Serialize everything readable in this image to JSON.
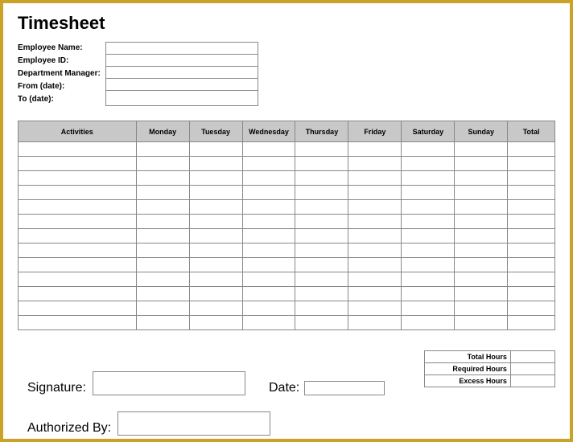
{
  "title": "Timesheet",
  "header": {
    "labels": {
      "employee_name": "Employee Name:",
      "employee_id": "Employee ID:",
      "department_manager": "Department Manager:",
      "from_date": "From (date):",
      "to_date": "To (date):"
    },
    "values": {
      "employee_name": "",
      "employee_id": "",
      "department_manager": "",
      "from_date": "",
      "to_date": ""
    }
  },
  "table": {
    "columns": [
      "Activities",
      "Monday",
      "Tuesday",
      "Wednesday",
      "Thursday",
      "Friday",
      "Saturday",
      "Sunday",
      "Total"
    ],
    "rows": [
      [
        "",
        "",
        "",
        "",
        "",
        "",
        "",
        "",
        ""
      ],
      [
        "",
        "",
        "",
        "",
        "",
        "",
        "",
        "",
        ""
      ],
      [
        "",
        "",
        "",
        "",
        "",
        "",
        "",
        "",
        ""
      ],
      [
        "",
        "",
        "",
        "",
        "",
        "",
        "",
        "",
        ""
      ],
      [
        "",
        "",
        "",
        "",
        "",
        "",
        "",
        "",
        ""
      ],
      [
        "",
        "",
        "",
        "",
        "",
        "",
        "",
        "",
        ""
      ],
      [
        "",
        "",
        "",
        "",
        "",
        "",
        "",
        "",
        ""
      ],
      [
        "",
        "",
        "",
        "",
        "",
        "",
        "",
        "",
        ""
      ],
      [
        "",
        "",
        "",
        "",
        "",
        "",
        "",
        "",
        ""
      ],
      [
        "",
        "",
        "",
        "",
        "",
        "",
        "",
        "",
        ""
      ],
      [
        "",
        "",
        "",
        "",
        "",
        "",
        "",
        "",
        ""
      ],
      [
        "",
        "",
        "",
        "",
        "",
        "",
        "",
        "",
        ""
      ],
      [
        "",
        "",
        "",
        "",
        "",
        "",
        "",
        "",
        ""
      ]
    ]
  },
  "summary": {
    "total_hours_label": "Total Hours",
    "required_hours_label": "Required Hours",
    "excess_hours_label": "Excess Hours",
    "total_hours": "",
    "required_hours": "",
    "excess_hours": ""
  },
  "footer": {
    "signature_label": "Signature:",
    "date_label": "Date:",
    "authorized_by_label": "Authorized By:",
    "signature": "",
    "date": "",
    "authorized_by": ""
  }
}
